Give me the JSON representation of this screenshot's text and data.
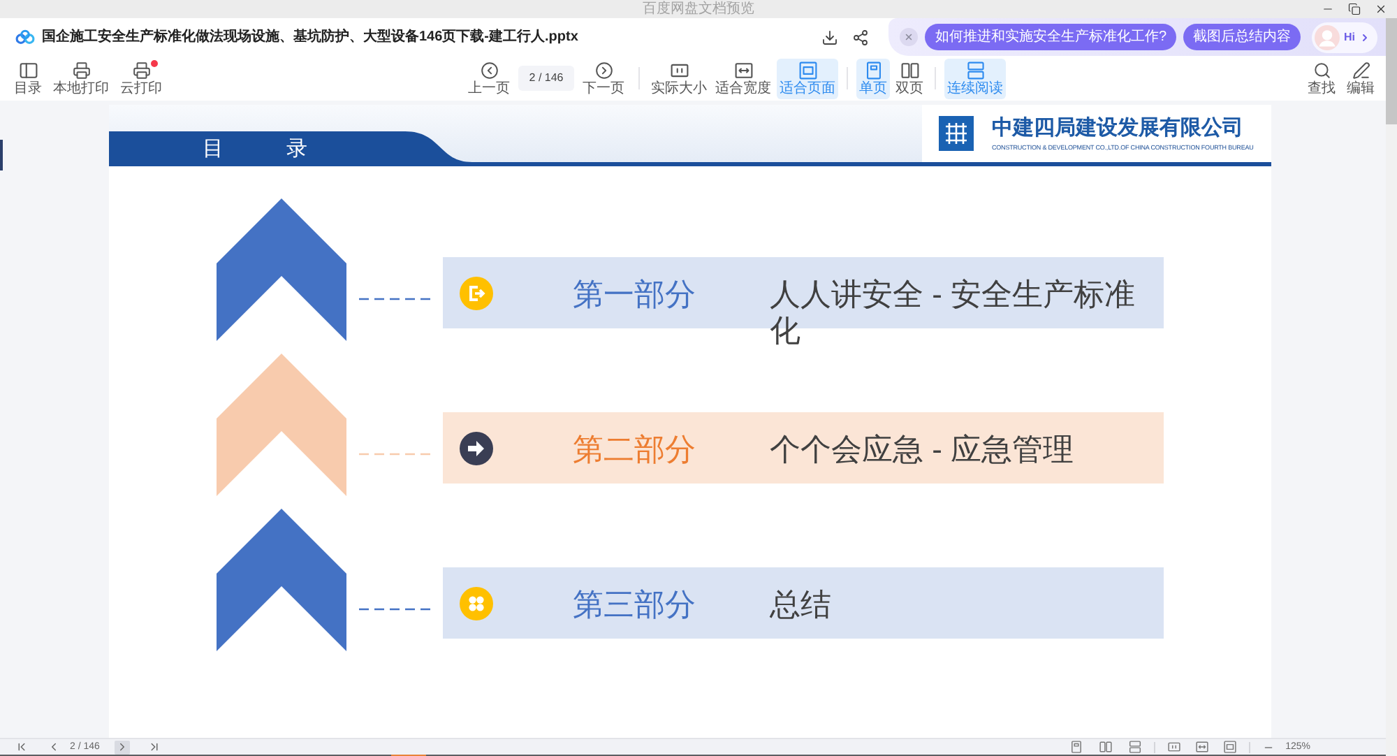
{
  "window": {
    "title": "百度网盘文档预览"
  },
  "document": {
    "file_name": "国企施工安全生产标准化做法现场设施、基坑防护、大型设备146页下载-建工行人.pptx"
  },
  "assistant": {
    "suggestions": [
      "如何推进和实施安全生产标准化工作?",
      "截图后总结内容"
    ],
    "greeting": "Hi"
  },
  "toolbar": {
    "left_tools": [
      {
        "label": "目录",
        "notification": false
      },
      {
        "label": "本地打印",
        "notification": false
      },
      {
        "label": "云打印",
        "notification": true
      }
    ],
    "page_nav": {
      "previous": "上一页",
      "page_value": "2",
      "page_total": "/ 146",
      "next": "下一页"
    },
    "zoom_modes": [
      {
        "label": "实际大小",
        "selected": false
      },
      {
        "label": "适合宽度",
        "selected": false
      },
      {
        "label": "适合页面",
        "selected": true
      }
    ],
    "page_modes": [
      {
        "label": "单页",
        "selected": true
      },
      {
        "label": "双页",
        "selected": false
      }
    ],
    "scroll_modes": [
      {
        "label": "连续阅读",
        "selected": true
      }
    ],
    "right_tools": [
      {
        "label": "查找"
      },
      {
        "label": "编辑"
      }
    ]
  },
  "slide": {
    "heading": "目　　　录",
    "company_name": "中建四局建设发展有限公司",
    "company_name_en": "CONSTRUCTION & DEVELOPMENT CO.,LTD.OF CHINA CONSTRUCTION FOURTH BUREAU",
    "sections": [
      {
        "kind": "exit",
        "color": "#4472c4",
        "chevron": {
          "color": "#4472c4"
        },
        "label": "第一部分",
        "title": "人人讲安全 - 安全生产标准化"
      },
      {
        "kind": "arrow",
        "color": "#ed7d31",
        "chevron": {
          "color": "#f8cbad"
        },
        "label": "第二部分",
        "title": "个个会应急 - 应急管理"
      },
      {
        "kind": "clover",
        "color": "#4472c4",
        "chevron": {
          "color": "#4472c4"
        },
        "label": "第三部分",
        "title": "总结"
      }
    ]
  },
  "status_bar": {
    "nav": [
      {
        "hovered": false
      },
      {
        "hovered": false
      },
      {
        "hovered": true
      },
      {
        "hovered": false
      }
    ],
    "page": "2 / 146",
    "zoom": "125%"
  }
}
